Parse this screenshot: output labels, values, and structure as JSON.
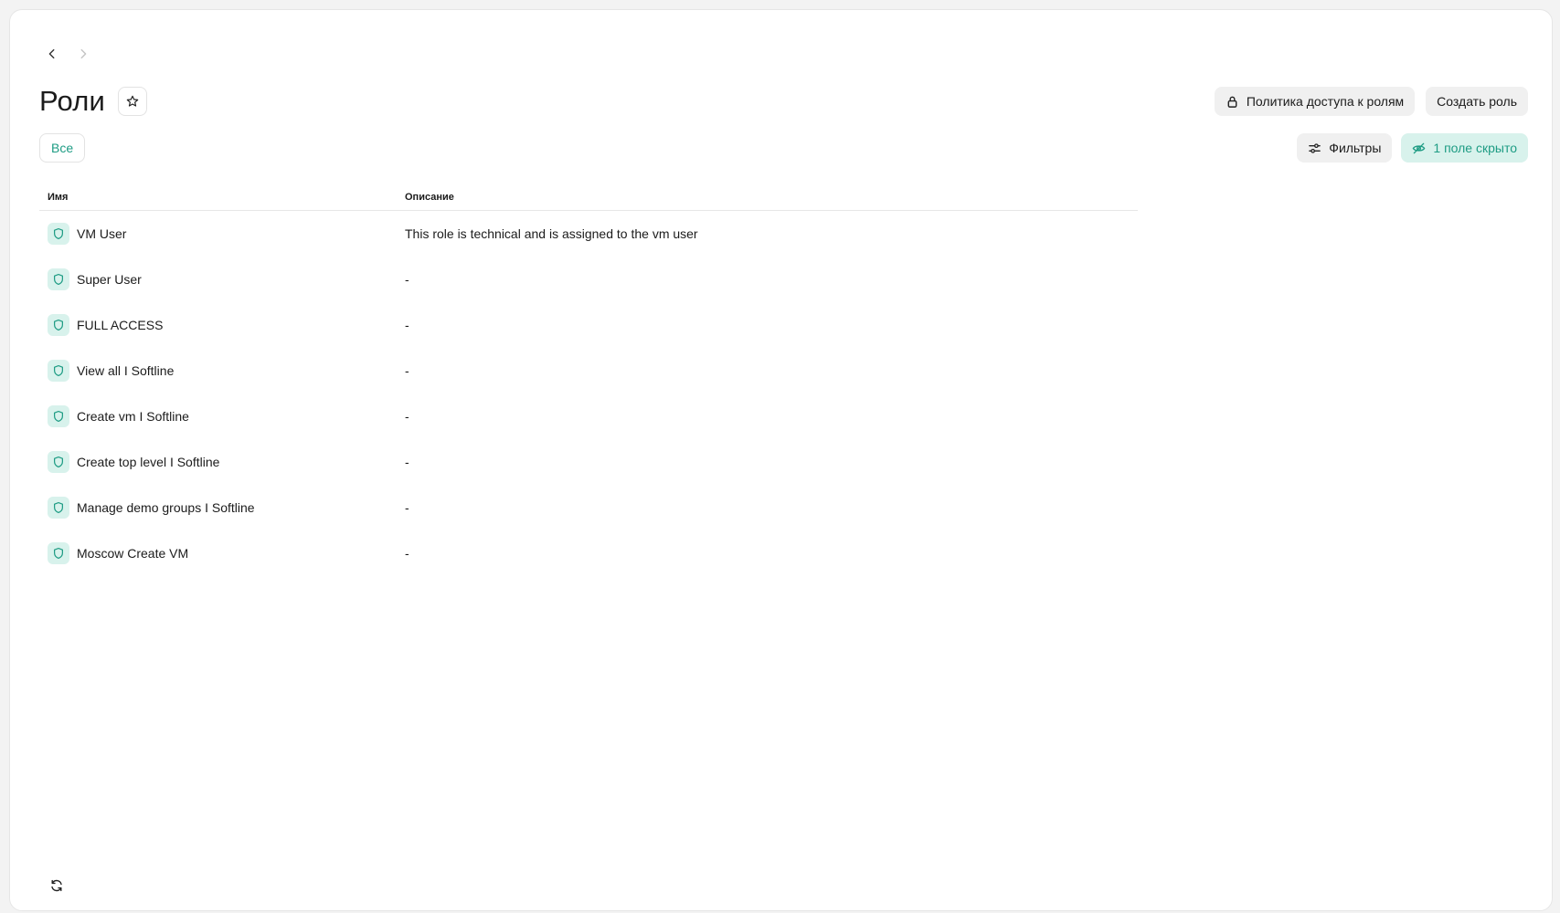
{
  "page": {
    "title": "Роли"
  },
  "header": {
    "access_policy_label": "Политика доступа к ролям",
    "create_role_label": "Создать роль"
  },
  "filters": {
    "all_label": "Все",
    "filters_label": "Фильтры",
    "hidden_fields_label": "1 поле скрыто"
  },
  "table": {
    "columns": {
      "name": "Имя",
      "description": "Описание"
    },
    "rows": [
      {
        "name": "VM User",
        "description": "This role is technical and is assigned to the vm user"
      },
      {
        "name": "Super User",
        "description": "-"
      },
      {
        "name": "FULL ACCESS",
        "description": "-"
      },
      {
        "name": "View all I Softline",
        "description": "-"
      },
      {
        "name": "Create vm I Softline",
        "description": "-"
      },
      {
        "name": "Create top level I Softline",
        "description": "-"
      },
      {
        "name": "Manage demo groups I Softline",
        "description": "-"
      },
      {
        "name": "Moscow Create VM",
        "description": "-"
      }
    ]
  },
  "colors": {
    "accent": "#1e9c84",
    "accent_bg": "#d8f2ec"
  },
  "icons": {
    "back": "chevron-left-icon",
    "forward": "chevron-right-icon",
    "favorite": "star-icon",
    "lock": "lock-icon",
    "filters": "sliders-icon",
    "hidden": "eye-off-icon",
    "role": "shield-icon",
    "refresh": "refresh-icon"
  }
}
